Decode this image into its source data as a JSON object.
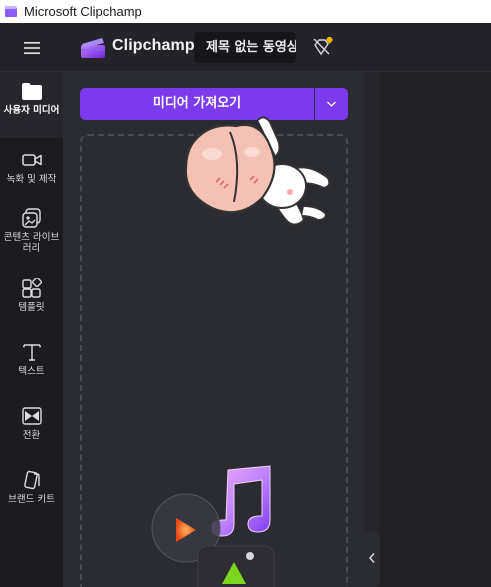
{
  "window": {
    "title": "Microsoft Clipchamp",
    "icon": "clipchamp-app-icon"
  },
  "header": {
    "menu_icon": "hamburger-menu-icon",
    "brand": "Clipchamp",
    "project_title": "제목 없는 동영상",
    "premium_icon": "premium-diamond-icon"
  },
  "rail": {
    "items": [
      {
        "label": "사용자 미디어",
        "icon": "folder-icon",
        "active": true
      },
      {
        "label": "녹화 및 제작",
        "icon": "video-camera-icon",
        "active": false
      },
      {
        "label": "콘텐츠 라이브러리",
        "icon": "library-icon",
        "active": false
      },
      {
        "label": "템플릿",
        "icon": "templates-icon",
        "active": false
      },
      {
        "label": "텍스트",
        "icon": "text-icon",
        "active": false
      },
      {
        "label": "전환",
        "icon": "transition-icon",
        "active": false
      },
      {
        "label": "브랜드 키트",
        "icon": "brand-kit-icon",
        "active": false
      }
    ]
  },
  "panel": {
    "import_button": "미디어 가져오기",
    "import_dropdown_icon": "chevron-down-icon"
  },
  "collapse_icon": "chevron-left-icon",
  "colors": {
    "accent": "#7c3aed",
    "background": "#212126",
    "panel": "#2b2b32",
    "rail": "#1b1b20"
  }
}
